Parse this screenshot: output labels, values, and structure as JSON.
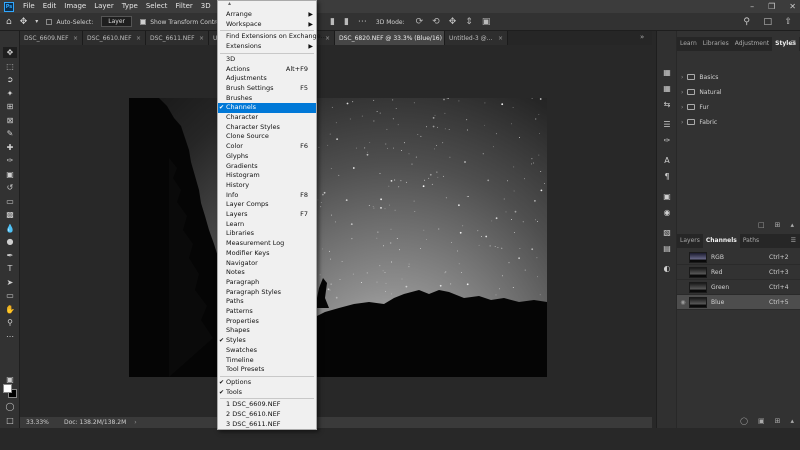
{
  "app": {
    "logo": "Ps"
  },
  "menubar": {
    "items": [
      "File",
      "Edit",
      "Image",
      "Layer",
      "Type",
      "Select",
      "Filter",
      "3D",
      "View",
      "Window"
    ],
    "active": "Window",
    "window_controls": [
      "minimize-icon",
      "restore-icon",
      "close-icon"
    ]
  },
  "options": {
    "auto_select_label": "Auto-Select:",
    "auto_select_checked": false,
    "layer_select": "Layer",
    "show_transform_label": "Show Transform Controls",
    "show_transform_checked": true,
    "mode3d_label": "3D Mode:"
  },
  "tabs": [
    {
      "label": "DSC_6609.NEF",
      "active": false
    },
    {
      "label": "DSC_6610.NEF",
      "active": false
    },
    {
      "label": "DSC_6611.NEF",
      "active": false
    },
    {
      "label": "Untitled-2 @...",
      "active": false
    },
    {
      "label": "DSC_6612-2",
      "active": false
    },
    {
      "label": "DSC_6820.NEF @ 33.3% (Blue/16)",
      "active": true
    },
    {
      "label": "Untitled-3 @...",
      "active": false
    }
  ],
  "status": {
    "zoom": "33.33%",
    "doc": "Doc: 138.2M/138.2M"
  },
  "styles_panel": {
    "tabs": [
      "Learn",
      "Libraries",
      "Adjustment",
      "Styles"
    ],
    "active_tab": "Styles",
    "folders": [
      "Basics",
      "Natural",
      "Fur",
      "Fabric"
    ]
  },
  "channels_panel": {
    "tabs": [
      "Layers",
      "Channels",
      "Paths"
    ],
    "active_tab": "Channels",
    "channels": [
      {
        "name": "RGB",
        "shortcut": "Ctrl+2",
        "selected": false,
        "visible": false
      },
      {
        "name": "Red",
        "shortcut": "Ctrl+3",
        "selected": false,
        "visible": false
      },
      {
        "name": "Green",
        "shortcut": "Ctrl+4",
        "selected": false,
        "visible": false
      },
      {
        "name": "Blue",
        "shortcut": "Ctrl+5",
        "selected": true,
        "visible": true
      }
    ]
  },
  "window_menu": {
    "top": [
      {
        "label": "Arrange",
        "submenu": true
      },
      {
        "label": "Workspace",
        "submenu": true
      }
    ],
    "mid": [
      {
        "label": "Find Extensions on Exchange..."
      },
      {
        "label": "Extensions",
        "submenu": true
      }
    ],
    "panels": [
      {
        "label": "3D"
      },
      {
        "label": "Actions",
        "shortcut": "Alt+F9"
      },
      {
        "label": "Adjustments"
      },
      {
        "label": "Brush Settings",
        "shortcut": "F5"
      },
      {
        "label": "Brushes"
      },
      {
        "label": "Channels",
        "checked": true,
        "highlighted": true
      },
      {
        "label": "Character"
      },
      {
        "label": "Character Styles"
      },
      {
        "label": "Clone Source"
      },
      {
        "label": "Color",
        "shortcut": "F6"
      },
      {
        "label": "Glyphs"
      },
      {
        "label": "Gradients"
      },
      {
        "label": "Histogram"
      },
      {
        "label": "History"
      },
      {
        "label": "Info",
        "shortcut": "F8"
      },
      {
        "label": "Layer Comps"
      },
      {
        "label": "Layers",
        "shortcut": "F7"
      },
      {
        "label": "Learn"
      },
      {
        "label": "Libraries"
      },
      {
        "label": "Measurement Log"
      },
      {
        "label": "Modifier Keys"
      },
      {
        "label": "Navigator"
      },
      {
        "label": "Notes"
      },
      {
        "label": "Paragraph"
      },
      {
        "label": "Paragraph Styles"
      },
      {
        "label": "Paths"
      },
      {
        "label": "Patterns"
      },
      {
        "label": "Properties"
      },
      {
        "label": "Shapes"
      },
      {
        "label": "Styles",
        "checked": true
      },
      {
        "label": "Swatches"
      },
      {
        "label": "Timeline"
      },
      {
        "label": "Tool Presets"
      }
    ],
    "options_tools": [
      {
        "label": "Options",
        "checked": true
      },
      {
        "label": "Tools",
        "checked": true
      }
    ],
    "recent": [
      {
        "label": "1 DSC_6609.NEF"
      },
      {
        "label": "2 DSC_6610.NEF"
      },
      {
        "label": "3 DSC_6611.NEF"
      }
    ]
  }
}
